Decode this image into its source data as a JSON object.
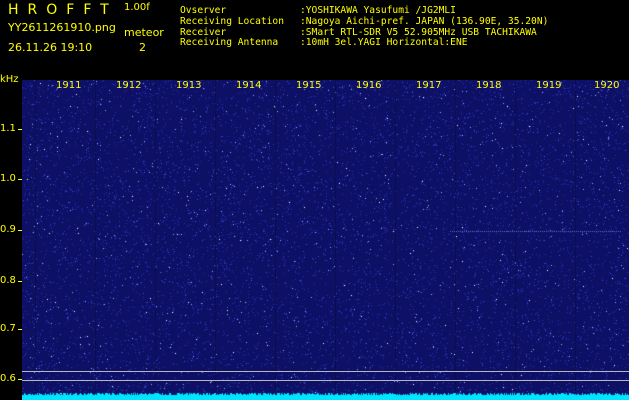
{
  "header": {
    "app_title": "HROFFT",
    "version": "1.00f",
    "filename": "YY2611261910.png",
    "datetime": "26.11.26 19:10",
    "meteor_label": "meteor",
    "meteor_count": "2"
  },
  "info": [
    {
      "label": "Ovserver",
      "value": ":YOSHIKAWA Yasufumi /JG2MLI"
    },
    {
      "label": "Receiving Location",
      "value": ":Nagoya Aichi-pref. JAPAN (136.90E, 35.20N)"
    },
    {
      "label": "Receiver",
      "value": ":SMart RTL-SDR V5 52.905MHz USB TACHIKAWA"
    },
    {
      "label": "Receiving Antenna",
      "value": ":10mH 3el.YAGI Horizontal:ENE"
    }
  ],
  "axis": {
    "y_unit": "kHz",
    "y_labels": [
      "1.1",
      "1.0",
      "0.9",
      "0.8",
      "0.7",
      "0.6"
    ],
    "x_labels": [
      "1911",
      "1912",
      "1913",
      "1914",
      "1915",
      "1916",
      "1917",
      "1918",
      "1919",
      "1920"
    ]
  },
  "colors": {
    "text": "#ffff00",
    "background": "#000000",
    "spectrum_bg": "#0e1066",
    "noise_floor": "#00e5ff",
    "scale_lines": "#b8b8b8"
  }
}
